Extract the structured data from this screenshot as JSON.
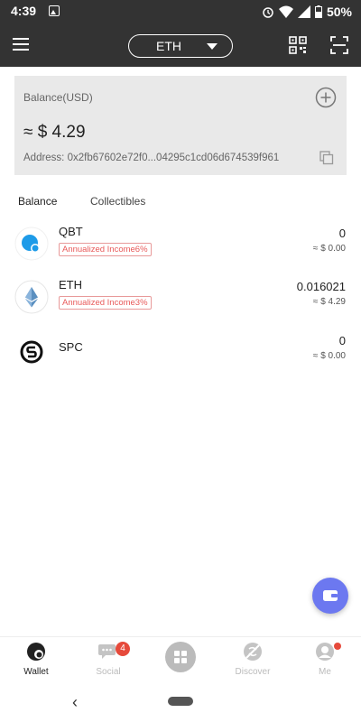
{
  "status_bar": {
    "time": "4:39",
    "battery": "50%"
  },
  "header": {
    "network": "ETH"
  },
  "balance_card": {
    "label": "Balance(USD)",
    "value": "≈ $ 4.29",
    "address": "Address: 0x2fb67602e72f0...04295c1cd06d674539f961"
  },
  "tabs": [
    {
      "label": "Balance",
      "active": true
    },
    {
      "label": "Collectibles",
      "active": false
    }
  ],
  "tokens": [
    {
      "name": "QBT",
      "badge": "Annualized Income6%",
      "amount": "0",
      "usd": "≈ $ 0.00",
      "icon": "qbt-icon"
    },
    {
      "name": "ETH",
      "badge": "Annualized Income3%",
      "amount": "0.016021",
      "usd": "≈ $ 4.29",
      "icon": "ethereum-icon"
    },
    {
      "name": "SPC",
      "badge": "",
      "amount": "0",
      "usd": "≈ $ 0.00",
      "icon": "spc-icon"
    }
  ],
  "bottom_nav": [
    {
      "label": "Wallet",
      "icon": "wallet-icon",
      "active": true
    },
    {
      "label": "Social",
      "icon": "chat-icon",
      "badge": "4"
    },
    {
      "label": "",
      "icon": "apps-icon"
    },
    {
      "label": "Discover",
      "icon": "discover-icon"
    },
    {
      "label": "Me",
      "icon": "person-icon",
      "dot": true
    }
  ],
  "colors": {
    "header_bg": "#333333",
    "card_bg": "#e9e9e9",
    "fab": "#6c78f0",
    "badge_red": "#e85a5a",
    "notification": "#e64a3b"
  }
}
